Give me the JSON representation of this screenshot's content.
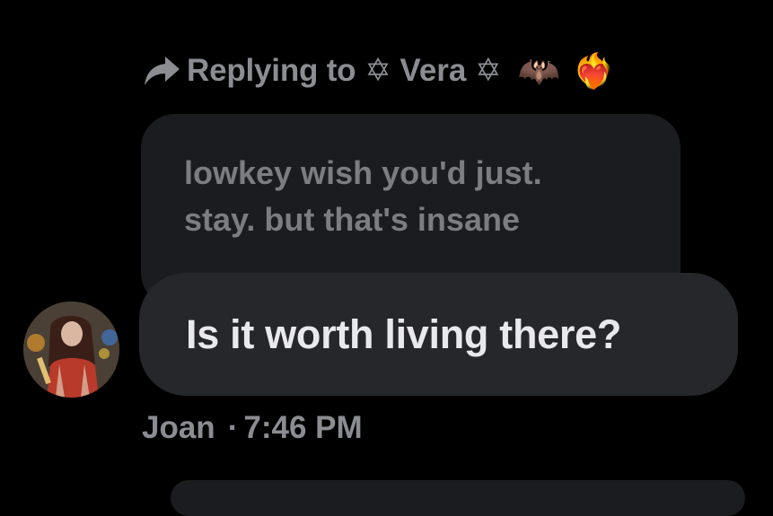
{
  "reply": {
    "prefix": "Replying to",
    "name": "✡ Vera ✡",
    "emoji_1": "🦇",
    "emoji_2": "❤️‍🔥",
    "arrow_icon": "reply-arrow-icon"
  },
  "quoted": {
    "text": "lowkey wish you'd just.\nstay. but that's insane"
  },
  "message": {
    "text": "Is it worth living there?"
  },
  "sender": {
    "name": "Joan",
    "separator": "·",
    "time": "7:46 PM"
  },
  "colors": {
    "background": "#000000",
    "quoted_bubble": "#1b1c1f",
    "message_bubble": "#26272b",
    "muted_text": "#8b8d92",
    "message_text": "#e9e9ec"
  }
}
